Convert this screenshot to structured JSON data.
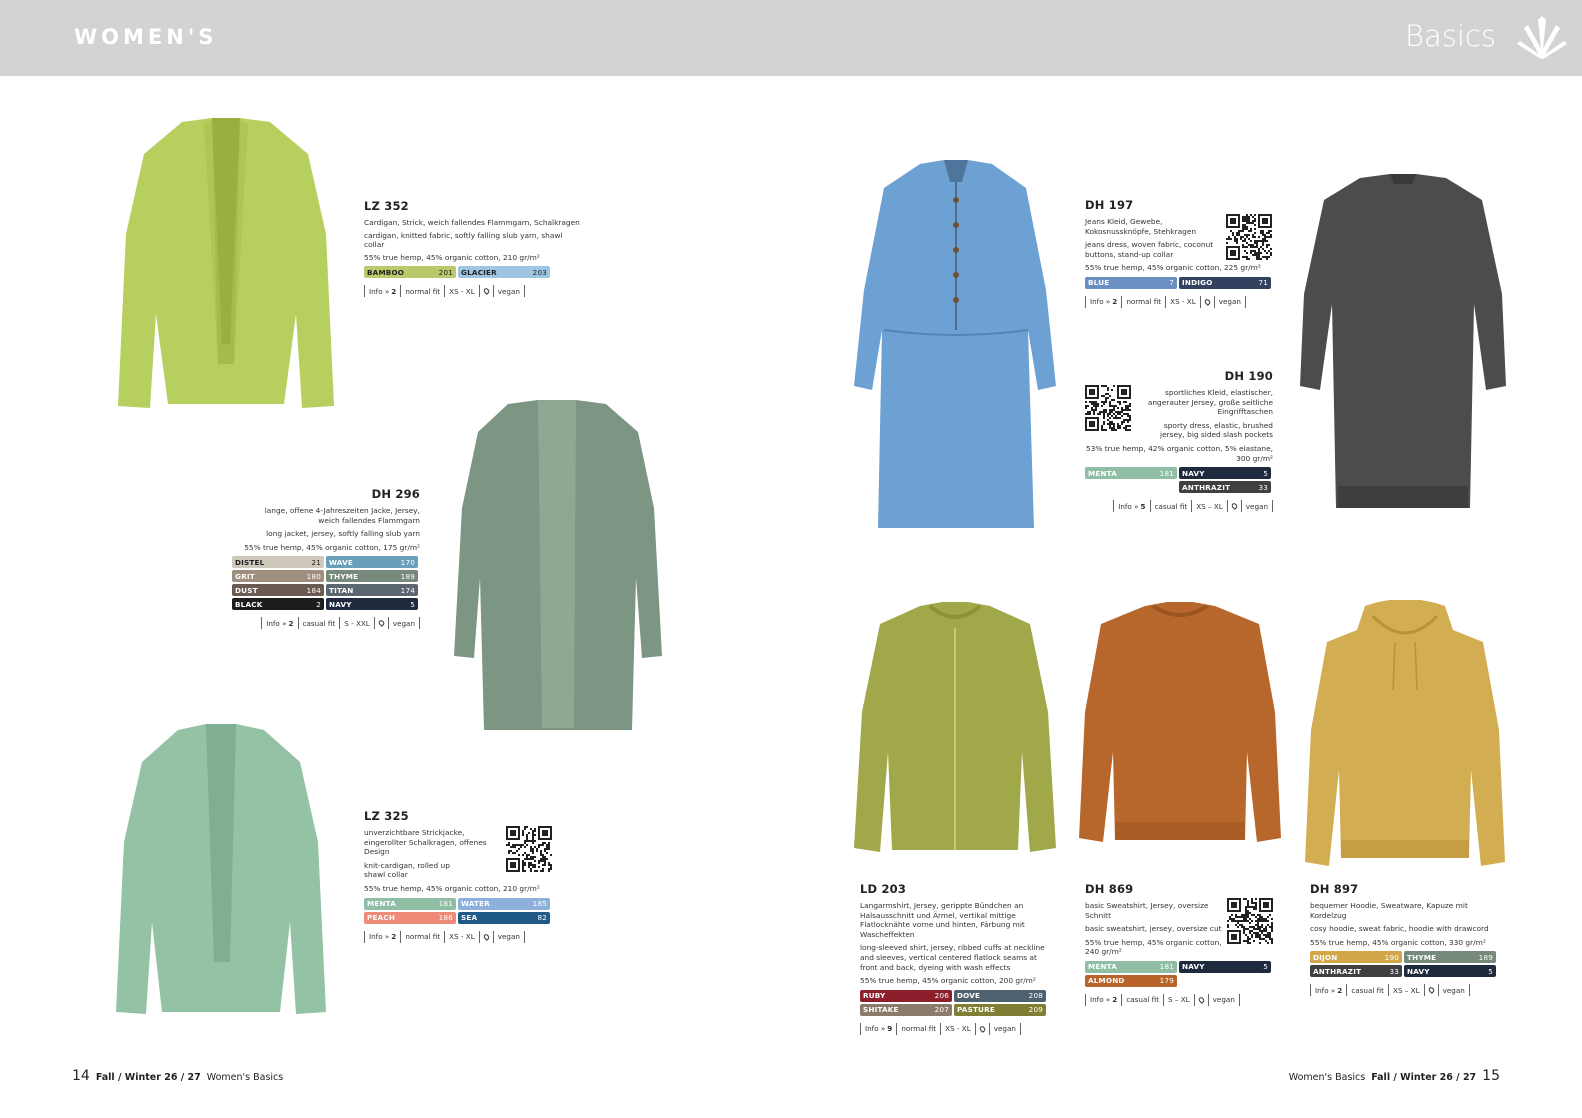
{
  "header": {
    "section": "WOMEN'S",
    "category": "Basics"
  },
  "footer": {
    "left": {
      "page": "14",
      "season": "Fall / Winter 26 / 27",
      "title": "Women's Basics"
    },
    "right": {
      "title": "Women's Basics",
      "season": "Fall / Winter 26 / 27",
      "page": "15"
    }
  },
  "products": {
    "lz352": {
      "code": "LZ 352",
      "de": "Cardigan, Strick, weich fallendes Flammgarn, Schalkragen",
      "en": "cardigan, knitted fabric, softly falling slub yarn, shawl collar",
      "composition": "55% true hemp, 45% organic cotton, 210 gr/m²",
      "colors": [
        {
          "name": "BAMBOO",
          "num": "201",
          "hex": "#b9c96b"
        },
        {
          "name": "GLACIER",
          "num": "203",
          "hex": "#9ec6e3"
        }
      ],
      "info": {
        "label": "Info »",
        "value": "2",
        "fit": "normal fit",
        "sizes": "XS - XL",
        "vegan": "vegan"
      }
    },
    "dh296": {
      "code": "DH 296",
      "de": "lange, offene 4-Jahreszeiten Jacke, Jersey, weich fallendes Flammgarn",
      "en": "long jacket, jersey, softly falling slub yarn",
      "composition": "55% true hemp, 45% organic cotton, 175 gr/m²",
      "colors": [
        {
          "name": "DISTEL",
          "num": "21",
          "hex": "#cfc8bc"
        },
        {
          "name": "WAVE",
          "num": "170",
          "hex": "#6a9fb9"
        },
        {
          "name": "GRIT",
          "num": "180",
          "hex": "#a08f7e"
        },
        {
          "name": "THYME",
          "num": "189",
          "hex": "#77897a"
        },
        {
          "name": "DUST",
          "num": "184",
          "hex": "#6b5a51"
        },
        {
          "name": "TITAN",
          "num": "174",
          "hex": "#5b6670"
        },
        {
          "name": "BLACK",
          "num": "2",
          "hex": "#1d1d1d"
        },
        {
          "name": "NAVY",
          "num": "5",
          "hex": "#1f2a3f"
        }
      ],
      "info": {
        "label": "Info »",
        "value": "2",
        "fit": "casual fit",
        "sizes": "S - XXL",
        "vegan": "vegan"
      }
    },
    "lz325": {
      "code": "LZ 325",
      "de": "unverzichtbare Strickjacke, eingerollter Schalkragen, offenes Design",
      "en": "knit-cardigan, rolled up shawl collar",
      "composition": "55% true hemp, 45% organic cotton, 210 gr/m²",
      "colors": [
        {
          "name": "MENTA",
          "num": "181",
          "hex": "#8fbea5"
        },
        {
          "name": "WATER",
          "num": "185",
          "hex": "#8db0dc"
        },
        {
          "name": "PEACH",
          "num": "186",
          "hex": "#ee8a78"
        },
        {
          "name": "SEA",
          "num": "82",
          "hex": "#1f5b86"
        }
      ],
      "info": {
        "label": "Info »",
        "value": "2",
        "fit": "normal fit",
        "sizes": "XS - XL",
        "vegan": "vegan"
      }
    },
    "dh197": {
      "code": "DH 197",
      "de": "Jeans Kleid, Gewebe, Kokosnussknöpfe, Stehkragen",
      "en": "jeans dress, woven fabric, coconut buttons, stand-up collar",
      "composition": "55% true hemp, 45% organic cotton, 225 gr/m²",
      "colors": [
        {
          "name": "BLUE",
          "num": "7",
          "hex": "#6b8fc1"
        },
        {
          "name": "INDIGO",
          "num": "71",
          "hex": "#34425f"
        }
      ],
      "info": {
        "label": "Info »",
        "value": "2",
        "fit": "normal fit",
        "sizes": "XS - XL",
        "vegan": "vegan"
      }
    },
    "dh190": {
      "code": "DH 190",
      "de": "sportliches Kleid, elastischer, angerauter Jersey, große seitliche Eingrifftaschen",
      "en": "sporty dress, elastic, brushed jersey, big sided slash pockets",
      "composition": "53% true hemp, 42% organic cotton, 5% elastane, 300 gr/m²",
      "colors": [
        {
          "name": "MENTA",
          "num": "181",
          "hex": "#8fbea5"
        },
        {
          "name": "NAVY",
          "num": "5",
          "hex": "#1f2a3f"
        },
        {
          "name": "ANTHRAZIT",
          "num": "33",
          "hex": "#3f4042"
        }
      ],
      "info": {
        "label": "Info »",
        "value": "5",
        "fit": "casual fit",
        "sizes": "XS – XL",
        "vegan": "vegan"
      }
    },
    "ld203": {
      "code": "LD 203",
      "de": "Langarmshirt, Jersey, gerippte Bündchen an Halsausschnitt und Ärmel, vertikal mittige Flatlocknähte vorne und hinten, Färbung mit Wascheffekten",
      "en": "long-sleeved shirt, jersey, ribbed cuffs at neckline and sleeves, vertical centered flatlock seams at front and back, dyeing with wash effects",
      "composition": "55% true hemp, 45% organic cotton, 200 gr/m²",
      "colors": [
        {
          "name": "RUBY",
          "num": "206",
          "hex": "#8c1f2c"
        },
        {
          "name": "DOVE",
          "num": "208",
          "hex": "#4e6171"
        },
        {
          "name": "SHITAKE",
          "num": "207",
          "hex": "#8b7b6b"
        },
        {
          "name": "PASTURE",
          "num": "209",
          "hex": "#7f7e34"
        }
      ],
      "info": {
        "label": "Info »",
        "value": "9",
        "fit": "normal fit",
        "sizes": "XS - XL",
        "vegan": "vegan"
      }
    },
    "dh869": {
      "code": "DH 869",
      "de": "basic Sweatshirt, Jersey, oversize Schnitt",
      "en": "basic sweatshirt, jersey, oversize cut",
      "composition": "55% true hemp, 45% organic cotton, 240 gr/m²",
      "colors": [
        {
          "name": "MENTA",
          "num": "181",
          "hex": "#8fbea5"
        },
        {
          "name": "NAVY",
          "num": "5",
          "hex": "#1f2a3f"
        },
        {
          "name": "ALMOND",
          "num": "179",
          "hex": "#b8632a"
        }
      ],
      "info": {
        "label": "Info »",
        "value": "2",
        "fit": "casual fit",
        "sizes": "S – XL",
        "vegan": "vegan"
      }
    },
    "dh897": {
      "code": "DH 897",
      "de": "bequemer Hoodie, Sweatware, Kapuze mit Kordelzug",
      "en": "cosy hoodie, sweat fabric, hoodie with drawcord",
      "composition": "55% true hemp, 45% organic cotton, 330 gr/m²",
      "colors": [
        {
          "name": "DIJON",
          "num": "190",
          "hex": "#d3a64a"
        },
        {
          "name": "THYME",
          "num": "189",
          "hex": "#77897a"
        },
        {
          "name": "ANTHRAZIT",
          "num": "33",
          "hex": "#3f4042"
        },
        {
          "name": "NAVY",
          "num": "5",
          "hex": "#1f2a3f"
        }
      ],
      "info": {
        "label": "Info »",
        "value": "2",
        "fit": "casual fit",
        "sizes": "XS – XL",
        "vegan": "vegan"
      }
    }
  },
  "garments": {
    "lz352": "#b7cf5e",
    "dh296": "#7c9683",
    "lz325": "#93c2a5",
    "dh197": "#6ea1d3",
    "dh190": "#4b4c4e",
    "ld203": "#a1a84a",
    "dh869": "#b8672c",
    "dh897": "#d2ad51"
  }
}
